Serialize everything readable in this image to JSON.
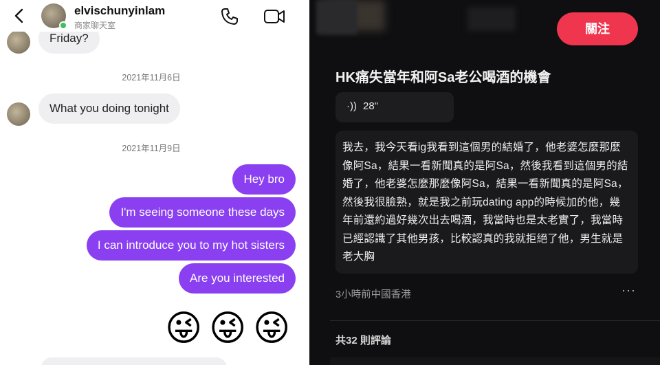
{
  "left": {
    "header": {
      "username": "elvischunyinlam",
      "status_text": "商家聊天室"
    },
    "messages": {
      "partial_top": "Friday?",
      "date1": "2021年11月6日",
      "incoming1": "What you doing tonight",
      "date2": "2021年11月9日",
      "outgoing": [
        "Hey bro",
        "I'm seeing someone these days",
        "I can introduce you to my hot sisters",
        "Are you interested"
      ],
      "emojis": [
        "😜",
        "😜",
        "😜"
      ]
    }
  },
  "right": {
    "follow_label": "關注",
    "title": "HK痛失當年和阿Sa老公喝酒的機會",
    "audio": {
      "icon": "·))",
      "duration": "28\""
    },
    "body_text": "我去，我今天看ig我看到這個男的結婚了，他老婆怎麼那麼像阿Sa，結果一看新聞真的是阿Sa，然後我看到這個男的結婚了，他老婆怎麼那麼像阿Sa，結果一看新聞真的是阿Sa，然後我很臉熟，就是我之前玩dating app的時候加的他，幾年前還約過好幾次出去喝酒，我當時也是太老實了，我當時已經認識了其他男孩，比較認真的我就拒絕了他，男生就是老大胸",
    "meta": "3小時前中國香港",
    "more": "···",
    "comments": "共32 則評論"
  },
  "colors": {
    "outgoing_bubble": "#8a3ff0",
    "incoming_bubble": "#efeff1",
    "follow_button": "#f0364f",
    "right_bg": "#0f0f11"
  }
}
